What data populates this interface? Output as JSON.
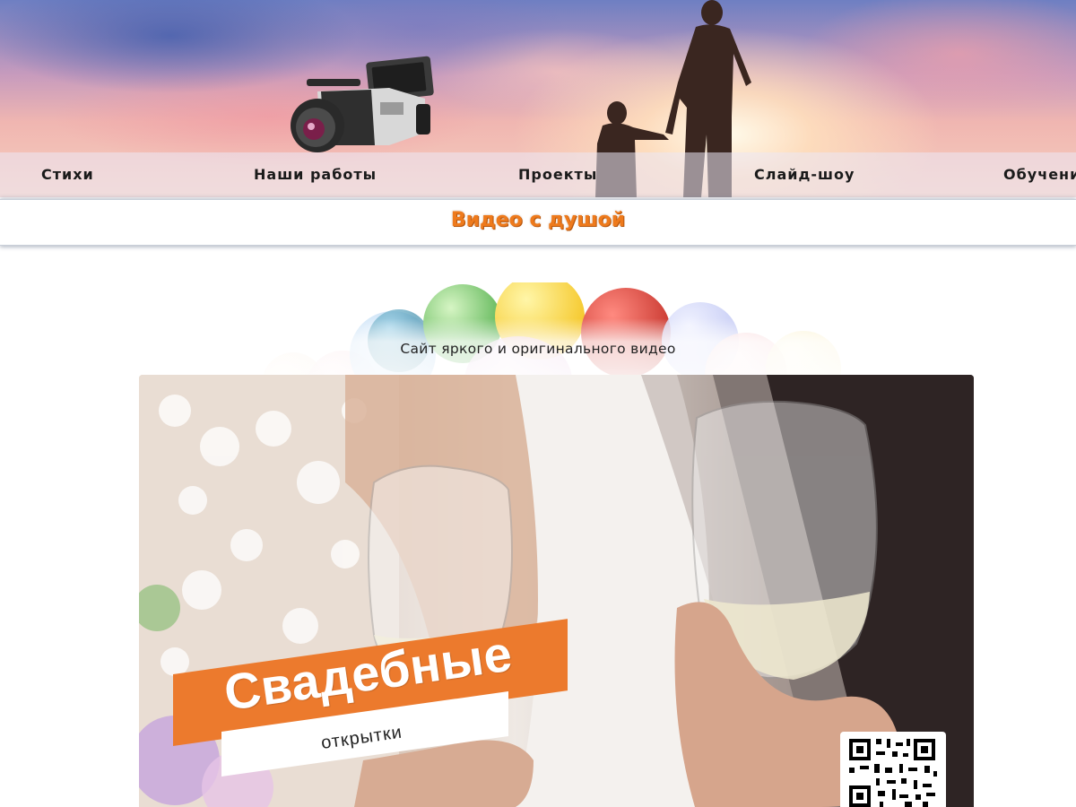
{
  "nav": {
    "items": [
      {
        "label": "Стихи"
      },
      {
        "label": "Наши работы"
      },
      {
        "label": "Проекты"
      },
      {
        "label": "Слайд-шоу"
      },
      {
        "label": "Обучени"
      }
    ]
  },
  "header": {
    "site_title": "Видео с душой"
  },
  "hero": {
    "subtitle": "Сайт яркого и оригинального видео"
  },
  "video_card": {
    "title": "Свадебные",
    "subtitle": "открытки"
  },
  "colors": {
    "accent": "#ee7a1c",
    "banner_orange": "#ec7a2d"
  },
  "icons": [
    "video-camera-icon",
    "qr-code-icon"
  ]
}
